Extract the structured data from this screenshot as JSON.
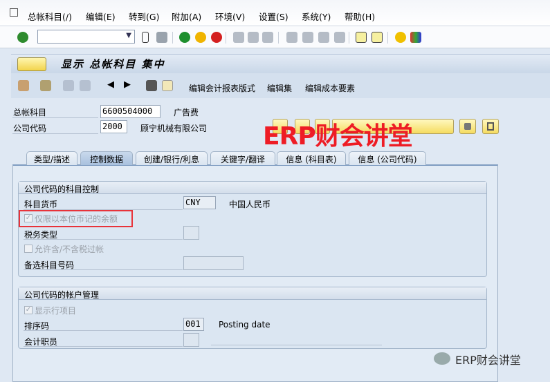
{
  "menu": [
    "总帐科目(/)",
    "编辑(E)",
    "转到(G)",
    "附加(A)",
    "环境(V)",
    "设置(S)",
    "系统(Y)",
    "帮助(H)"
  ],
  "title": "显示 总帐科目 集中",
  "app_toolbar": {
    "b1": "编辑会计报表版式",
    "b2": "编辑集",
    "b3": "编辑成本要素"
  },
  "header": {
    "gl_label": "总帐科目",
    "gl_value": "6600504000",
    "gl_desc": "广告费",
    "cc_label": "公司代码",
    "cc_value": "2000",
    "cc_desc": "顾宁机械有限公司"
  },
  "tabs": [
    "类型/描述",
    "控制数据",
    "创建/银行/利息",
    "关键字/翻译",
    "信息 (科目表)",
    "信息 (公司代码)"
  ],
  "group1": {
    "title": "公司代码的科目控制",
    "currency_label": "科目货币",
    "currency_value": "CNY",
    "currency_desc": "中国人民币",
    "local_only": "仅限以本位币记的余额",
    "tax_label": "税务类型",
    "allow_tax": "允许含/不含税过帐",
    "alt_label": "备选科目号码"
  },
  "group2": {
    "title": "公司代码的帐户管理",
    "show_items": "显示行项目",
    "sort_label": "排序码",
    "sort_value": "001",
    "sort_desc": "Posting date",
    "clerk_label": "会计职员"
  },
  "overlay": "ERP财会讲堂",
  "watermark": "ERP财会讲堂"
}
